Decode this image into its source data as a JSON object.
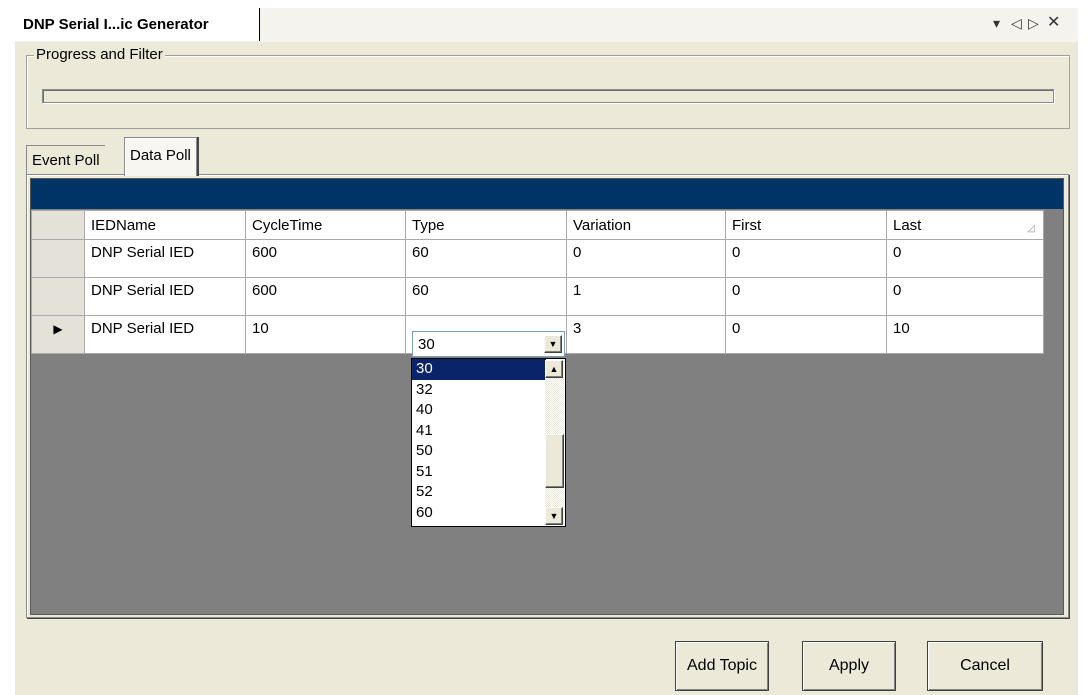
{
  "window": {
    "title": "DNP Serial I...ic Generator",
    "controls": {
      "dropdown": "▾",
      "prev": "◁",
      "next": "▷",
      "close": "✕"
    }
  },
  "progress_group": {
    "label": "Progress and Filter",
    "progress_fraction": 0
  },
  "tabs": [
    {
      "label": "Event Poll",
      "active": false
    },
    {
      "label": "Data Poll",
      "active": true
    }
  ],
  "grid": {
    "columns": [
      "IEDName",
      "CycleTime",
      "Type",
      "Variation",
      "First",
      "Last"
    ],
    "rows": [
      {
        "marker": "",
        "cells": [
          "DNP Serial IED",
          "600",
          "60",
          "0",
          "0",
          "0"
        ]
      },
      {
        "marker": "",
        "cells": [
          "DNP Serial IED",
          "600",
          "60",
          "1",
          "0",
          "0"
        ]
      },
      {
        "marker": "▶",
        "cells": [
          "DNP Serial IED",
          "10",
          "",
          "3",
          "0",
          "10"
        ]
      }
    ]
  },
  "type_combo": {
    "value": "30",
    "options": [
      "30",
      "32",
      "40",
      "41",
      "50",
      "51",
      "52",
      "60"
    ],
    "selected_option": "30"
  },
  "buttons": {
    "add_topic": "Add Topic",
    "apply": "Apply",
    "cancel": "Cancel"
  }
}
